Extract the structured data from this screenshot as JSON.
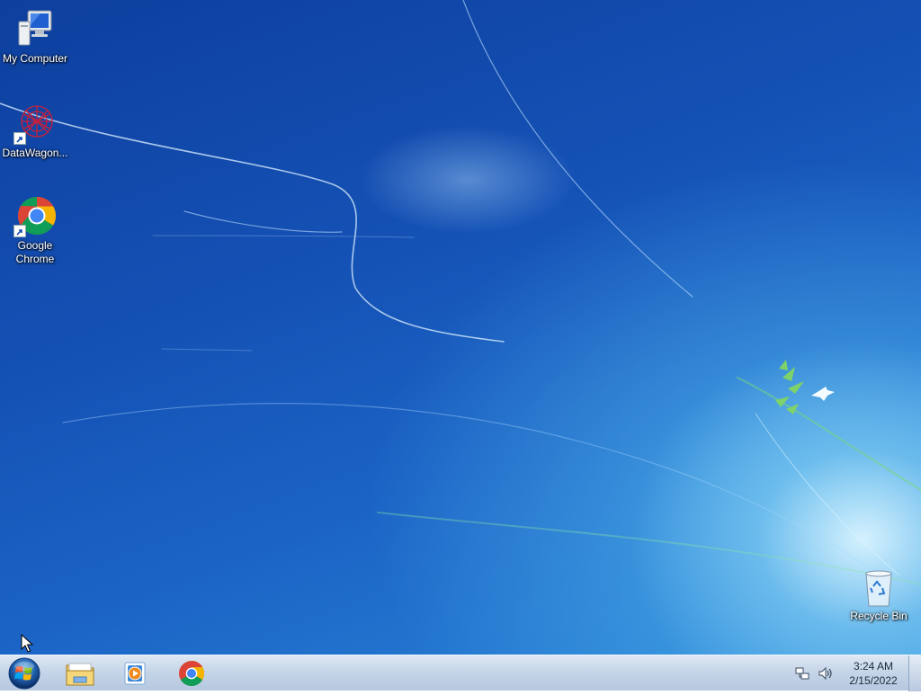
{
  "desktop": {
    "icons": [
      {
        "label": "My Computer",
        "icon": "computer-icon"
      },
      {
        "label": "DataWagon...",
        "icon": "datawagon-icon"
      },
      {
        "label": "Google Chrome",
        "icon": "chrome-icon"
      },
      {
        "label": "Recycle Bin",
        "icon": "recycle-bin-icon"
      }
    ]
  },
  "taskbar": {
    "start_icon": "windows-logo-icon",
    "pinned": [
      {
        "name": "Windows Explorer",
        "icon": "folder-icon"
      },
      {
        "name": "Windows Media Player",
        "icon": "media-player-icon"
      },
      {
        "name": "Google Chrome",
        "icon": "chrome-icon"
      }
    ],
    "tray": {
      "icons": [
        "network-icon",
        "volume-icon"
      ],
      "time": "3:24 AM",
      "date": "2/15/2022"
    }
  },
  "colors": {
    "taskbar_top": "#dfe8f3",
    "taskbar_bottom": "#b5c8e0",
    "wallpaper_dark": "#0d3f9e",
    "wallpaper_light": "#2a86d8"
  }
}
